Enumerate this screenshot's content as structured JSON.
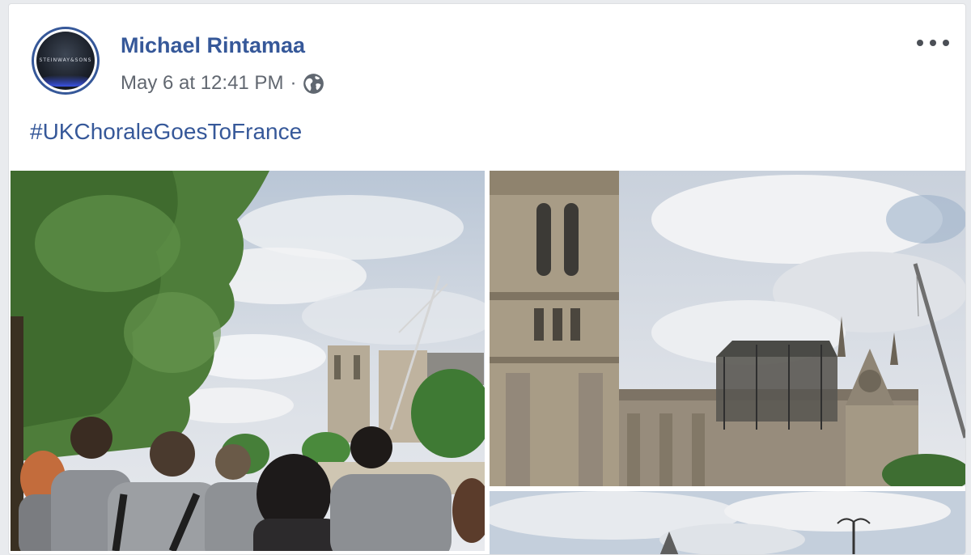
{
  "post": {
    "author": "Michael Rintamaa",
    "timestamp": "May 6 at 12:41 PM",
    "separator": "·",
    "privacy_icon": "globe-icon",
    "more_icon": "more-options-icon",
    "text": "#UKChoraleGoesToFrance"
  },
  "colors": {
    "link": "#365899",
    "meta": "#616770",
    "background": "#e9ebee"
  }
}
